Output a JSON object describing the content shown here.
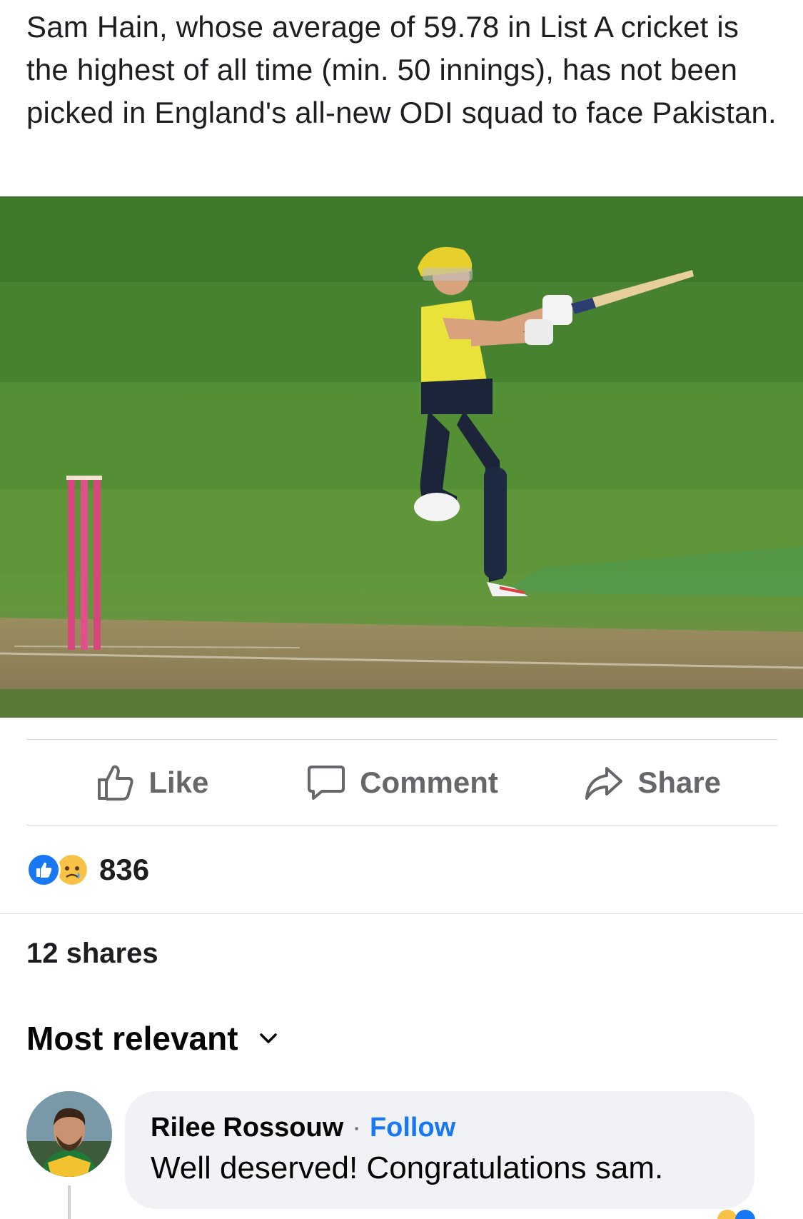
{
  "post": {
    "text": "Sam Hain, whose average of 59.78 in List A cricket is the highest of all time (min. 50 innings), has not been picked in England's all-new ODI squad to face Pakistan."
  },
  "actions": {
    "like_label": "Like",
    "comment_label": "Comment",
    "share_label": "Share"
  },
  "reactions": {
    "count": "836",
    "types": [
      "like-icon",
      "sad-face-icon"
    ]
  },
  "shares": {
    "text": "12 shares"
  },
  "comments": {
    "sort_label": "Most relevant",
    "items": [
      {
        "author": "Rilee Rossouw",
        "separator": "·",
        "follow_label": "Follow",
        "text": "Well deserved!  Congratulations sam."
      }
    ]
  },
  "colors": {
    "accent": "#1877f2",
    "secondary_text": "#65676b",
    "bubble_bg": "#f0f2f5",
    "divider": "#d9dadd"
  }
}
